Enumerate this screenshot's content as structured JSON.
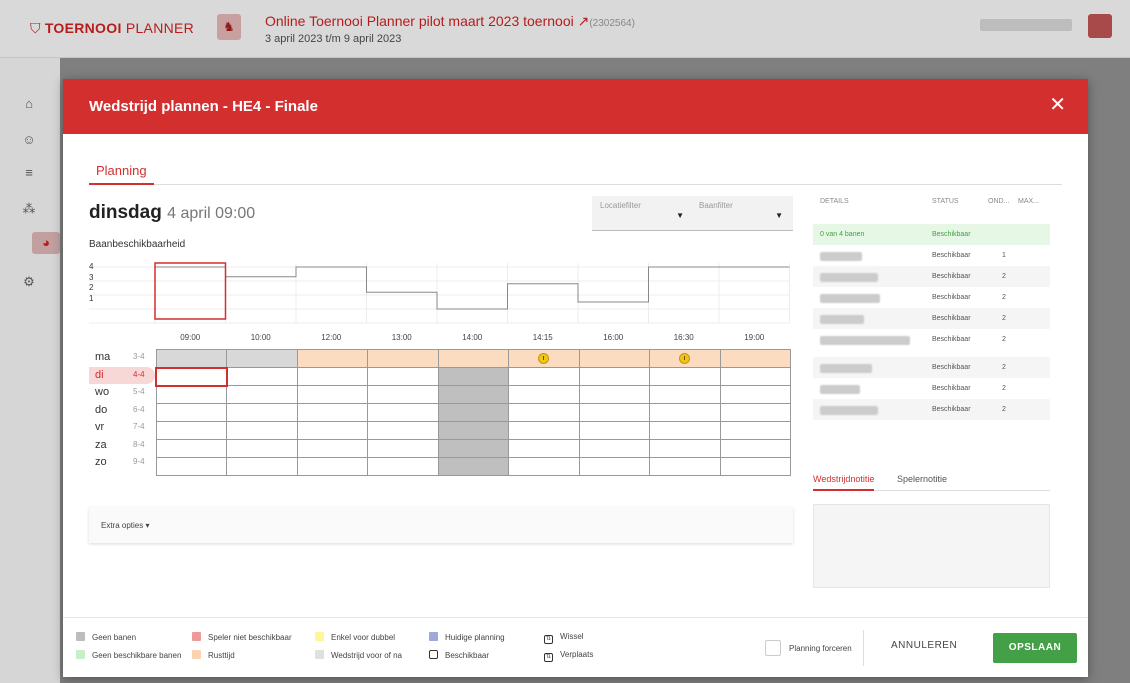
{
  "app": {
    "logo_bold": "TOERNOOI",
    "logo_rest": " PLANNER",
    "tournament_title": "Online Toernooi Planner pilot maart 2023 toernooi",
    "tournament_id": "(2302564)",
    "tournament_dates": "3 april 2023 t/m 9 april 2023"
  },
  "modal": {
    "title": "Wedstrijd plannen - HE4 - Finale",
    "close": "✕",
    "tab": "Planning",
    "day_name": "dinsdag",
    "day_date": "4 april 09:00",
    "location_filter": "Locatiefilter",
    "court_filter": "Baanfilter",
    "availability_title": "Baanbeschikbaarheid",
    "y_ticks": [
      "4",
      "3",
      "2",
      "1"
    ],
    "availability_levels": [
      4,
      3.3,
      4,
      2.2,
      1,
      2.8,
      1.5,
      4,
      4
    ],
    "times": [
      "09:00",
      "10:00",
      "12:00",
      "13:00",
      "14:00",
      "14:15",
      "16:00",
      "16:30",
      "19:00"
    ],
    "days": [
      {
        "name": "ma",
        "date": "3-4"
      },
      {
        "name": "di",
        "date": "4-4"
      },
      {
        "name": "wo",
        "date": "5-4"
      },
      {
        "name": "do",
        "date": "6-4"
      },
      {
        "name": "vr",
        "date": "7-4"
      },
      {
        "name": "za",
        "date": "8-4"
      },
      {
        "name": "zo",
        "date": "9-4"
      }
    ],
    "extra_options": "Extra opties ▾"
  },
  "details": {
    "headers": {
      "details": "DETAILS",
      "status": "STATUS",
      "ond": "OND...",
      "max": "MAX..."
    },
    "summary": {
      "label": "0 van 4 banen",
      "status": "Beschikbaar"
    },
    "rows": [
      {
        "status": "Beschikbaar",
        "ond": "1"
      },
      {
        "status": "Beschikbaar",
        "ond": "2"
      },
      {
        "status": "Beschikbaar",
        "ond": "2"
      },
      {
        "status": "Beschikbaar",
        "ond": "2"
      },
      {
        "status": "Beschikbaar",
        "ond": "2"
      },
      {
        "status": "Beschikbaar",
        "ond": "2"
      },
      {
        "status": "Beschikbaar",
        "ond": "2"
      },
      {
        "status": "Beschikbaar",
        "ond": "2"
      }
    ],
    "note_tabs": [
      "Wedstrijdnotitie",
      "Spelernotitie"
    ]
  },
  "legend": [
    {
      "label": "Geen banen",
      "color": "#bdbdbd",
      "kind": "fill"
    },
    {
      "label": "Speler niet beschikbaar",
      "color": "#ef9a9a",
      "kind": "fill"
    },
    {
      "label": "Enkel voor dubbel",
      "color": "#fff59d",
      "kind": "fill"
    },
    {
      "label": "Huidige planning",
      "color": "#9fa8da",
      "kind": "fill"
    },
    {
      "label": "Wissel",
      "color": "#ffffff",
      "kind": "icon"
    },
    {
      "label": "Geen beschikbare banen",
      "color": "#c8f0c8",
      "kind": "fill"
    },
    {
      "label": "Rusttijd",
      "color": "#fbd3b0",
      "kind": "fill"
    },
    {
      "label": "Wedstrijd voor of na",
      "color": "#e0e0e0",
      "kind": "fill"
    },
    {
      "label": "Beschikbaar",
      "color": "#ffffff",
      "kind": "box"
    },
    {
      "label": "Verplaats",
      "color": "#ffffff",
      "kind": "icon"
    }
  ],
  "footer": {
    "force_label": "Planning forceren",
    "cancel": "ANNULEREN",
    "save": "OPSLAAN"
  },
  "colors": {
    "brand": "#d32f2f",
    "save": "#43a047"
  }
}
